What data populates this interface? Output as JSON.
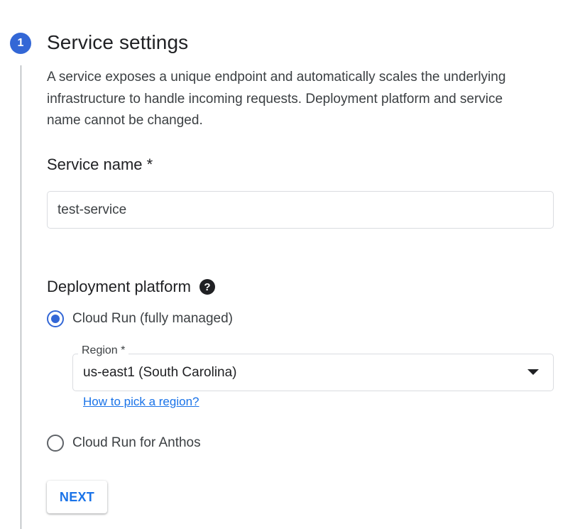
{
  "step": {
    "number": "1",
    "title": "Service settings",
    "description": "A service exposes a unique endpoint and automatically scales the underlying infrastructure to handle incoming requests. Deployment platform and service name cannot be changed."
  },
  "service_name": {
    "label": "Service name *",
    "value": "test-service"
  },
  "deployment_platform": {
    "label": "Deployment platform",
    "help_icon": "help-circle-icon",
    "options": [
      {
        "label": "Cloud Run (fully managed)",
        "selected": true
      },
      {
        "label": "Cloud Run for Anthos",
        "selected": false
      }
    ],
    "region": {
      "label": "Region *",
      "value": "us-east1 (South Carolina)",
      "help_link": "How to pick a region?"
    }
  },
  "actions": {
    "next_label": "NEXT"
  },
  "colors": {
    "accent": "#3367d6",
    "link": "#1a73e8",
    "border": "#dadce0"
  }
}
